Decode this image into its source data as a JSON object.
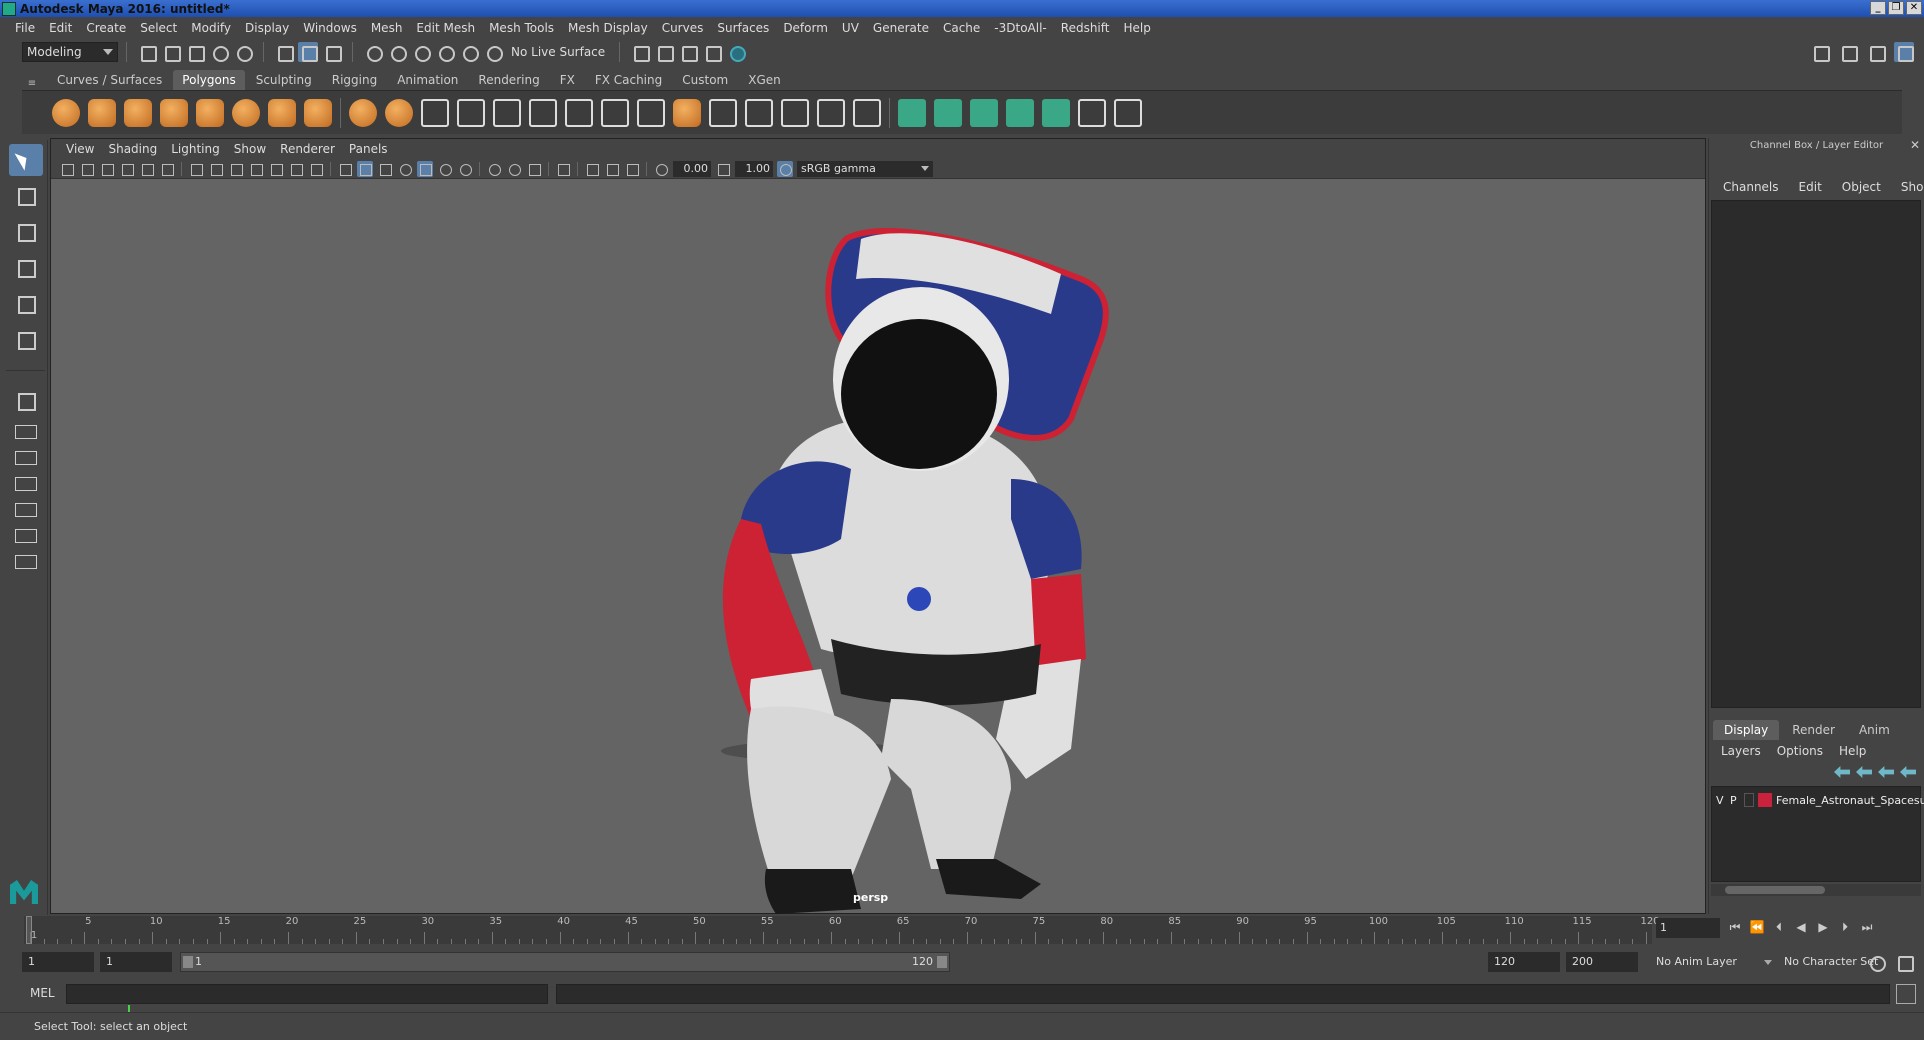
{
  "window": {
    "title": "Autodesk Maya 2016: untitled*",
    "buttons": [
      "_",
      "❐",
      "✕"
    ]
  },
  "menu": [
    "File",
    "Edit",
    "Create",
    "Select",
    "Modify",
    "Display",
    "Windows",
    "Mesh",
    "Edit Mesh",
    "Mesh Tools",
    "Mesh Display",
    "Curves",
    "Surfaces",
    "Deform",
    "UV",
    "Generate",
    "Cache",
    "-3DtoAll-",
    "Redshift",
    "Help"
  ],
  "statusline": {
    "mode": "Modeling",
    "live_surface": "No Live Surface"
  },
  "shelf": {
    "tabs": [
      "Curves / Surfaces",
      "Polygons",
      "Sculpting",
      "Rigging",
      "Animation",
      "Rendering",
      "FX",
      "FX Caching",
      "Custom",
      "XGen"
    ],
    "active_tab": "Polygons"
  },
  "viewport": {
    "menu": [
      "View",
      "Shading",
      "Lighting",
      "Show",
      "Renderer",
      "Panels"
    ],
    "exposure": "0.00",
    "gamma": "1.00",
    "color_space": "sRGB gamma",
    "camera": "persp"
  },
  "channel_box": {
    "title": "Channel Box / Layer Editor",
    "menu": [
      "Channels",
      "Edit",
      "Object",
      "Show"
    ]
  },
  "layer_editor": {
    "tabs": [
      "Display",
      "Render",
      "Anim"
    ],
    "active_tab": "Display",
    "menu": [
      "Layers",
      "Options",
      "Help"
    ],
    "layers": [
      {
        "v": "V",
        "p": "P",
        "name": "Female_Astronaut_Spacesuit",
        "color": "#c8223c"
      }
    ]
  },
  "timeline": {
    "ticks": [
      "1",
      "5",
      "10",
      "15",
      "20",
      "25",
      "30",
      "35",
      "40",
      "45",
      "50",
      "55",
      "60",
      "65",
      "70",
      "75",
      "80",
      "85",
      "90",
      "95",
      "100",
      "105",
      "110",
      "115",
      "120"
    ],
    "current_frame": "1"
  },
  "range": {
    "start": "1",
    "playback_start": "1",
    "slider_start": "1",
    "slider_end": "120",
    "playback_end": "120",
    "end": "200",
    "anim_layer": "No Anim Layer",
    "character_set": "No Character Set"
  },
  "command": {
    "language": "MEL"
  },
  "help_line": "Select Tool: select an object"
}
